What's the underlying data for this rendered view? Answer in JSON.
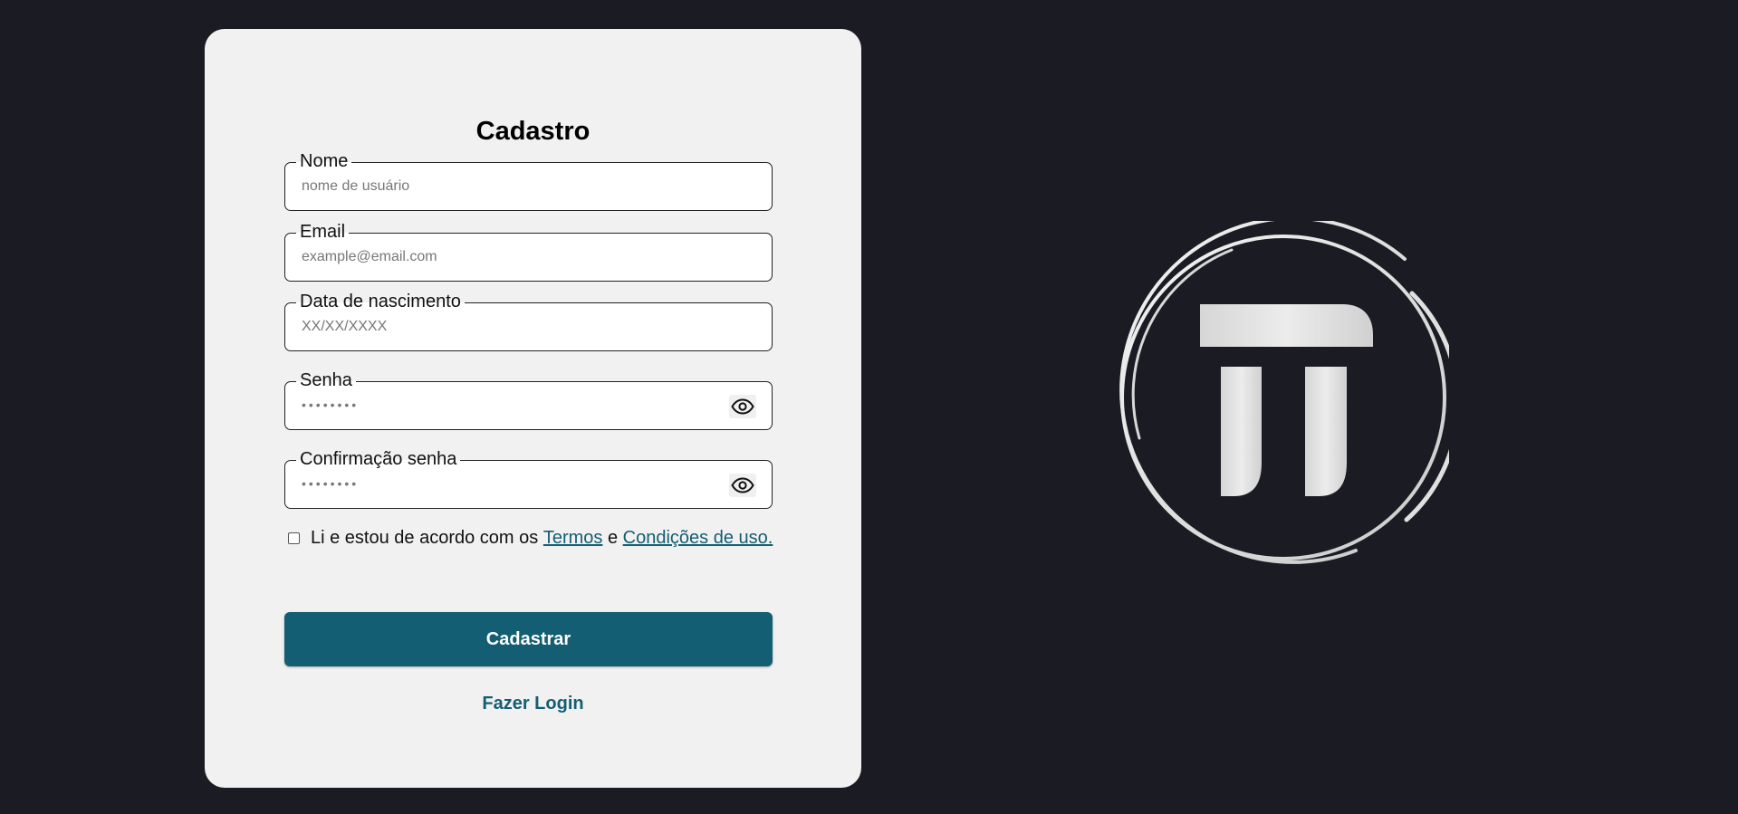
{
  "form": {
    "title": "Cadastro",
    "fields": [
      {
        "label": "Nome",
        "placeholder": "nome de usuário",
        "value": ""
      },
      {
        "label": "Email",
        "placeholder": "example@email.com",
        "value": ""
      },
      {
        "label": "Data de nascimento",
        "placeholder": "XX/XX/XXXX",
        "value": ""
      },
      {
        "label": "Senha",
        "placeholder": "••••••••",
        "value": ""
      },
      {
        "label": "Confirmação senha",
        "placeholder": "••••••••",
        "value": ""
      }
    ],
    "terms": {
      "checked": false,
      "text_before": "Li e estou de acordo com os",
      "terms_link": "Termos",
      "conjunction": "e",
      "conditions_link": "Condições de uso."
    },
    "submit_label": "Cadastrar",
    "login_label": "Fazer Login"
  },
  "logo": {
    "icon": "logo-icon"
  },
  "colors": {
    "background": "#1b1c23",
    "card": "#f1f1f1",
    "accent": "#135e72"
  }
}
